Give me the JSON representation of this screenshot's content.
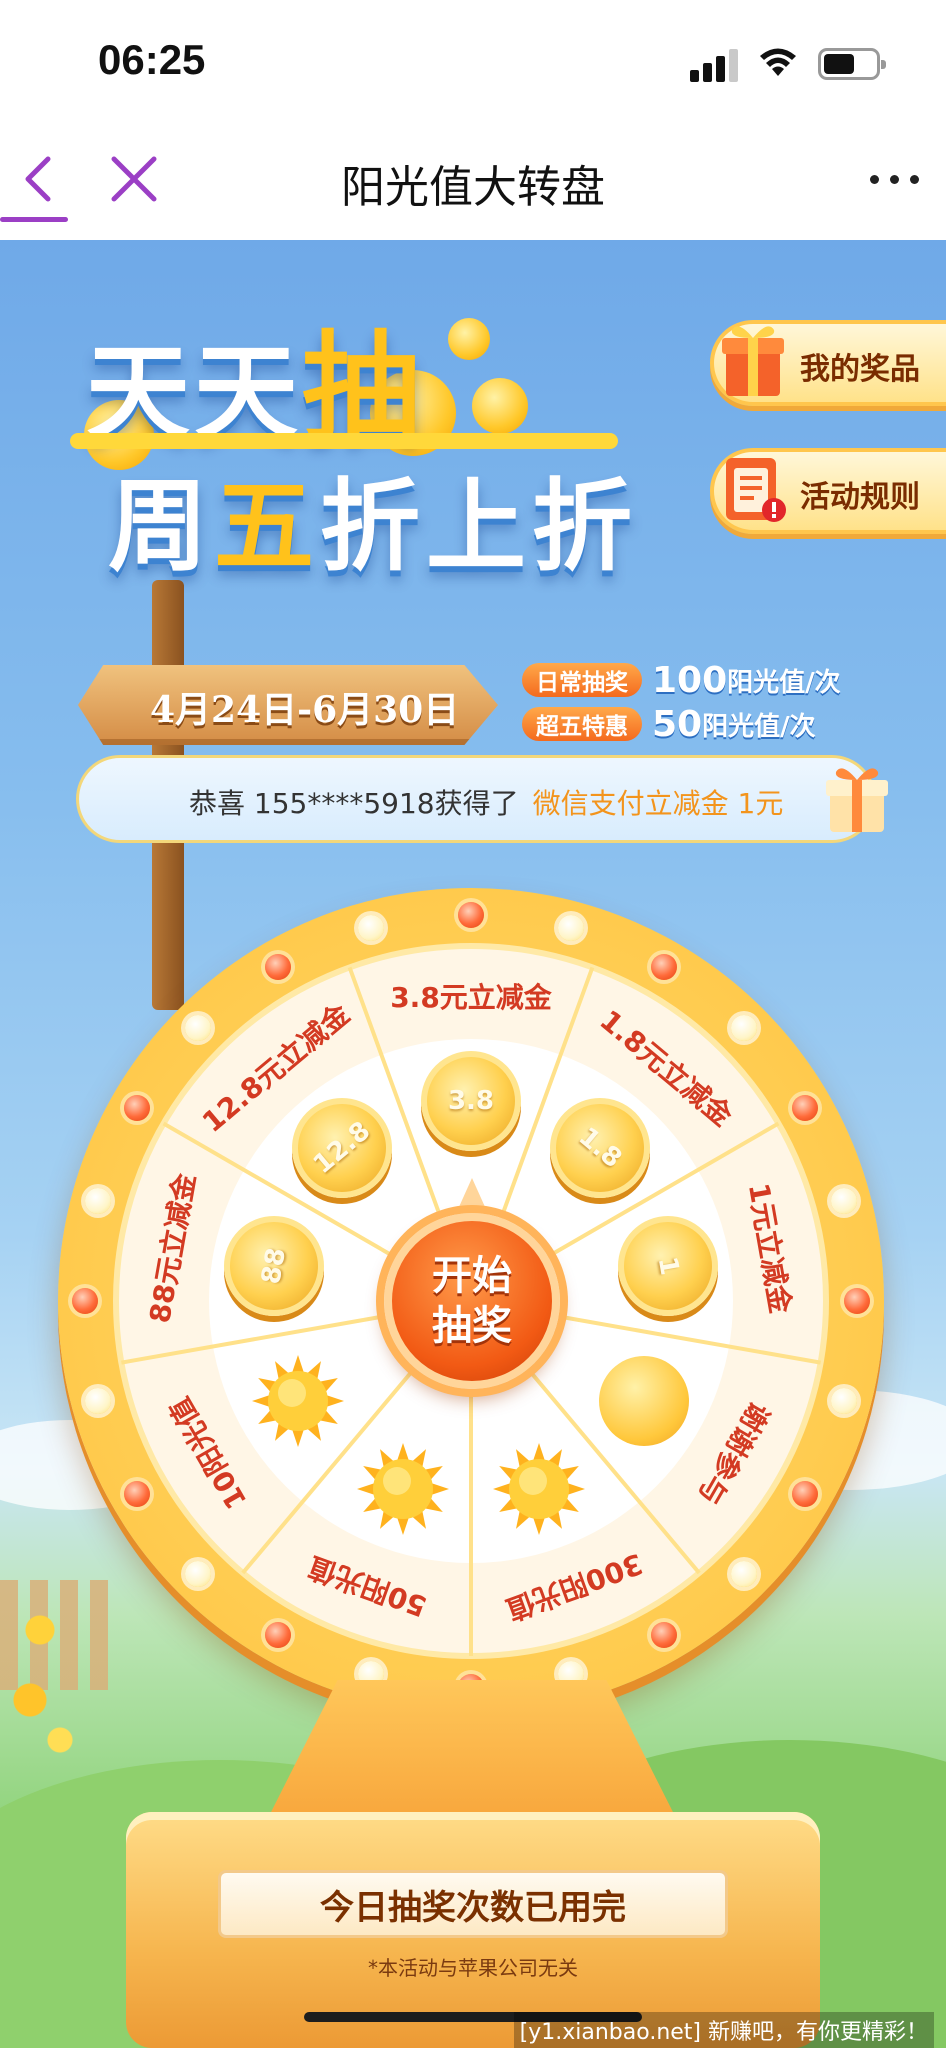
{
  "status_bar": {
    "time": "06:25"
  },
  "nav": {
    "title": "阳光值大转盘"
  },
  "banner": {
    "title_pre": "天天",
    "title_highlight": "抽",
    "subtitle_a": "周",
    "subtitle_highlight": "五",
    "subtitle_b": "折上折"
  },
  "side_buttons": {
    "prizes": "我的奖品",
    "rules": "活动规则"
  },
  "sign": {
    "date_range": "4月24日-6月30日"
  },
  "costs": [
    {
      "tag": "日常抽奖",
      "value": "100",
      "unit": "阳光值/次"
    },
    {
      "tag": "超五特惠",
      "value": "50",
      "unit": "阳光值/次"
    }
  ],
  "ticker": {
    "text": "恭喜 155****5918获得了",
    "highlight": "微信支付立减金 1元"
  },
  "wheel": {
    "segments": [
      {
        "label": "3.8元立减金",
        "coin": "3.8"
      },
      {
        "label": "1.8元立减金",
        "coin": "1.8"
      },
      {
        "label": "1元立减金",
        "coin": "1"
      },
      {
        "label": "谢谢参与"
      },
      {
        "label": "300阳光值"
      },
      {
        "label": "50阳光值"
      },
      {
        "label": "10阳光值"
      },
      {
        "label": "88元立减金",
        "coin": "88"
      },
      {
        "label": "12.8元立减金",
        "coin": "12.8"
      }
    ],
    "start_line1": "开始",
    "start_line2": "抽奖"
  },
  "footer": {
    "status": "今日抽奖次数已用完",
    "disclaimer": "*本活动与苹果公司无关"
  },
  "watermark": "[y1.xianbao.net] 新赚吧，有你更精彩！",
  "colors": {
    "accent_purple": "#9b3fc5",
    "wheel_gold": "#ffc94a",
    "label_red": "#d33a22",
    "button_orange": "#f25a14"
  }
}
